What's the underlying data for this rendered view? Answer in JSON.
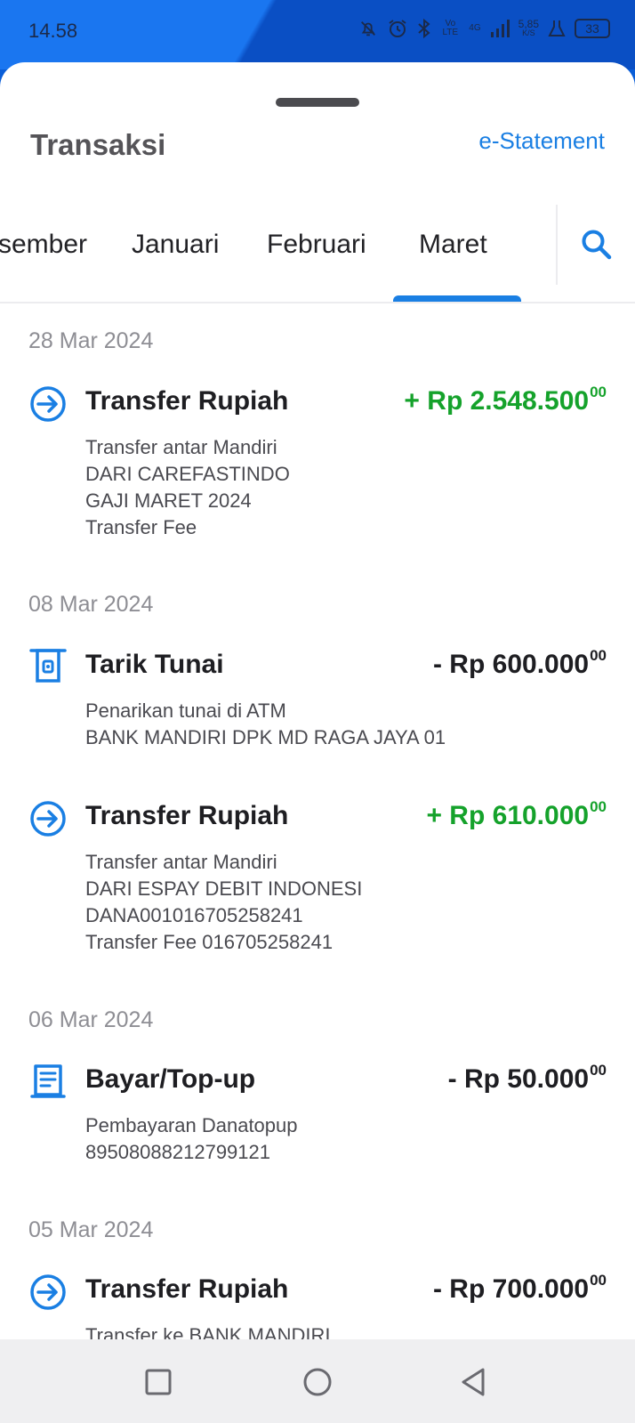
{
  "status_bar": {
    "time": "14.58",
    "net_volte": "Vo LTE",
    "net_4g": "4G",
    "speed": "5,85",
    "speed_unit": "K/S",
    "battery": "33",
    "icons": [
      "mute-bell-icon",
      "alarm-icon",
      "bluetooth-icon",
      "signal-icon",
      "flask-icon",
      "battery-icon"
    ]
  },
  "sheet": {
    "title": "Transaksi",
    "estatement_label": "e-Statement"
  },
  "tabs": {
    "items": [
      "sember",
      "Januari",
      "Februari",
      "Maret"
    ],
    "selected": "Maret",
    "accent": "#1a7fe3"
  },
  "groups": [
    {
      "date": "28 Mar 2024",
      "transactions": [
        {
          "icon": "transfer-in-icon",
          "title": "Transfer Rupiah",
          "amount": "+ Rp 2.548.500",
          "cents": "00",
          "type": "credit",
          "lines": [
            "Transfer antar Mandiri",
            "DARI CAREFASTINDO",
            "GAJI MARET 2024",
            "Transfer Fee"
          ]
        }
      ]
    },
    {
      "date": "08 Mar 2024",
      "transactions": [
        {
          "icon": "atm-withdraw-icon",
          "title": "Tarik Tunai",
          "amount": "- Rp 600.000",
          "cents": "00",
          "type": "debit",
          "lines": [
            "Penarikan tunai di ATM",
            "BANK MANDIRI DPK MD RAGA JAYA 01"
          ]
        },
        {
          "icon": "transfer-in-icon",
          "title": "Transfer Rupiah",
          "amount": "+ Rp 610.000",
          "cents": "00",
          "type": "credit",
          "lines": [
            "Transfer antar Mandiri",
            "DARI ESPAY DEBIT INDONESI",
            "DANA001016705258241",
            "Transfer Fee 016705258241"
          ]
        }
      ]
    },
    {
      "date": "06 Mar 2024",
      "transactions": [
        {
          "icon": "bill-payment-icon",
          "title": "Bayar/Top-up",
          "amount": "- Rp 50.000",
          "cents": "00",
          "type": "debit",
          "lines": [
            "Pembayaran Danatopup",
            "89508088212799121"
          ]
        }
      ]
    },
    {
      "date": "05 Mar 2024",
      "transactions": [
        {
          "icon": "transfer-in-icon",
          "title": "Transfer Rupiah",
          "amount": "- Rp 700.000",
          "cents": "00",
          "type": "debit",
          "lines": [
            "Transfer ke BANK MANDIRI"
          ]
        }
      ]
    }
  ],
  "colors": {
    "credit": "#15a22b",
    "debit": "#1e1e22",
    "icon": "#1a7fe3",
    "header_blue": "#1a76f0"
  },
  "navbar": {
    "icons": [
      "recents-square-icon",
      "home-circle-icon",
      "back-triangle-icon"
    ]
  }
}
